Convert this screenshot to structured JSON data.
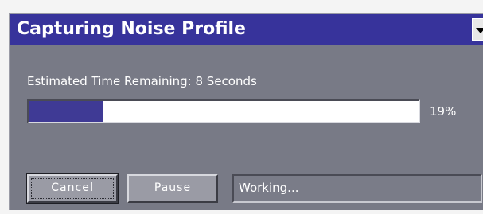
{
  "dialog": {
    "title": "Capturing Noise Profile",
    "menu_icon": "chevron-down-icon"
  },
  "progress": {
    "estimate_text": "Estimated Time Remaining: 8 Seconds",
    "percent_label": "19%",
    "fraction": 0.19
  },
  "buttons": {
    "cancel_label": "Cancel",
    "pause_label": "Pause"
  },
  "status": {
    "text": "Working..."
  },
  "colors": {
    "titlebar": "#37339b",
    "progress_fill": "#3f3a95",
    "panel": "#787a86"
  }
}
